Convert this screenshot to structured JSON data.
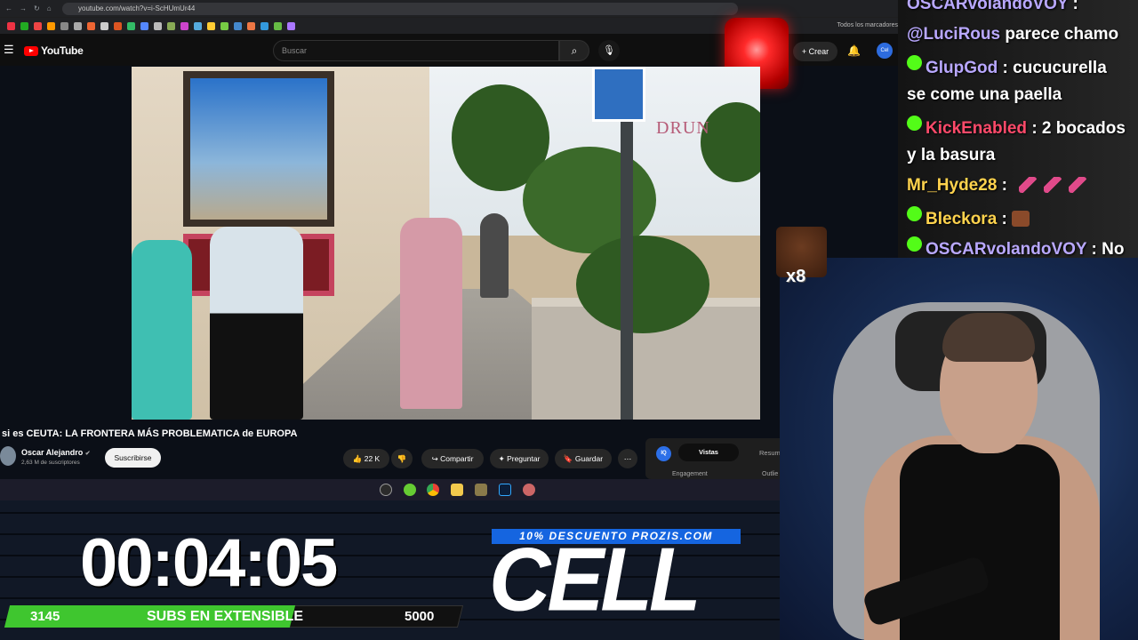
{
  "browser": {
    "url": "youtube.com/watch?v=i-ScHUmUr44",
    "bookmarks_folder": "Todos los marcadores"
  },
  "youtube": {
    "logo_text": "YouTube",
    "search_placeholder": "Buscar",
    "create_label": "+ Crear",
    "avatar_text": "Cel"
  },
  "video": {
    "title": "si es CEUTA: LA FRONTERA MÁS PROBLEMATICA de EUROPA",
    "sign_text": "DRUN",
    "channel": "Oscar Alejandro",
    "verified_icon": "✔",
    "subscribers": "2,63 M de suscriptores",
    "subscribe_label": "Suscribirse",
    "likes": "22 K",
    "share_label": "Compartir",
    "ask_label": "Preguntar",
    "save_label": "Guardar"
  },
  "stats_panel": {
    "badge": "IQ",
    "tab_active": "Vistas",
    "tab_other": "Resum",
    "label_1": "Engagement",
    "label_2": "Outlie"
  },
  "overlay": {
    "timer": "00:04:05",
    "subs_current": "3145",
    "subs_label": "SUBS EN EXTENSIBLE",
    "subs_goal": "5000",
    "subs_progress_pct": 63,
    "promo": "10% DESCUENTO PROZIS.COM",
    "brand": "CELL",
    "emote_multiplier": "x8"
  },
  "chat": [
    {
      "user": "OSCARvolandoVOY",
      "color": "#b9a8ff",
      "badge": false,
      "text": " :"
    },
    {
      "user": "@LuciRous",
      "color": "#b9a8ff",
      "badge": false,
      "text": " parece chamo"
    },
    {
      "user": "GlupGod",
      "color": "#b9a8ff",
      "badge": true,
      "text": " : cucucurella"
    },
    {
      "user": "",
      "color": "#ffffff",
      "badge": false,
      "text": "se come una paella"
    },
    {
      "user": "KickEnabled",
      "color": "#ff4a6a",
      "badge": true,
      "text": " : 2 bocados"
    },
    {
      "user": "",
      "color": "#ffffff",
      "badge": false,
      "text": "y la basura"
    },
    {
      "user": "Mr_Hyde28",
      "color": "#ffd34d",
      "badge": false,
      "text": " : "
    },
    {
      "user": "Bleckora",
      "color": "#ffd34d",
      "badge": true,
      "text": " : "
    },
    {
      "user": "OSCARvolandoVOY",
      "color": "#b9a8ff",
      "badge": true,
      "text": " : No"
    }
  ],
  "colors": {
    "accent_green": "#3fc62f",
    "kick_green": "#53fc18",
    "youtube_red": "#ff0000",
    "promo_blue": "#1565e0"
  }
}
